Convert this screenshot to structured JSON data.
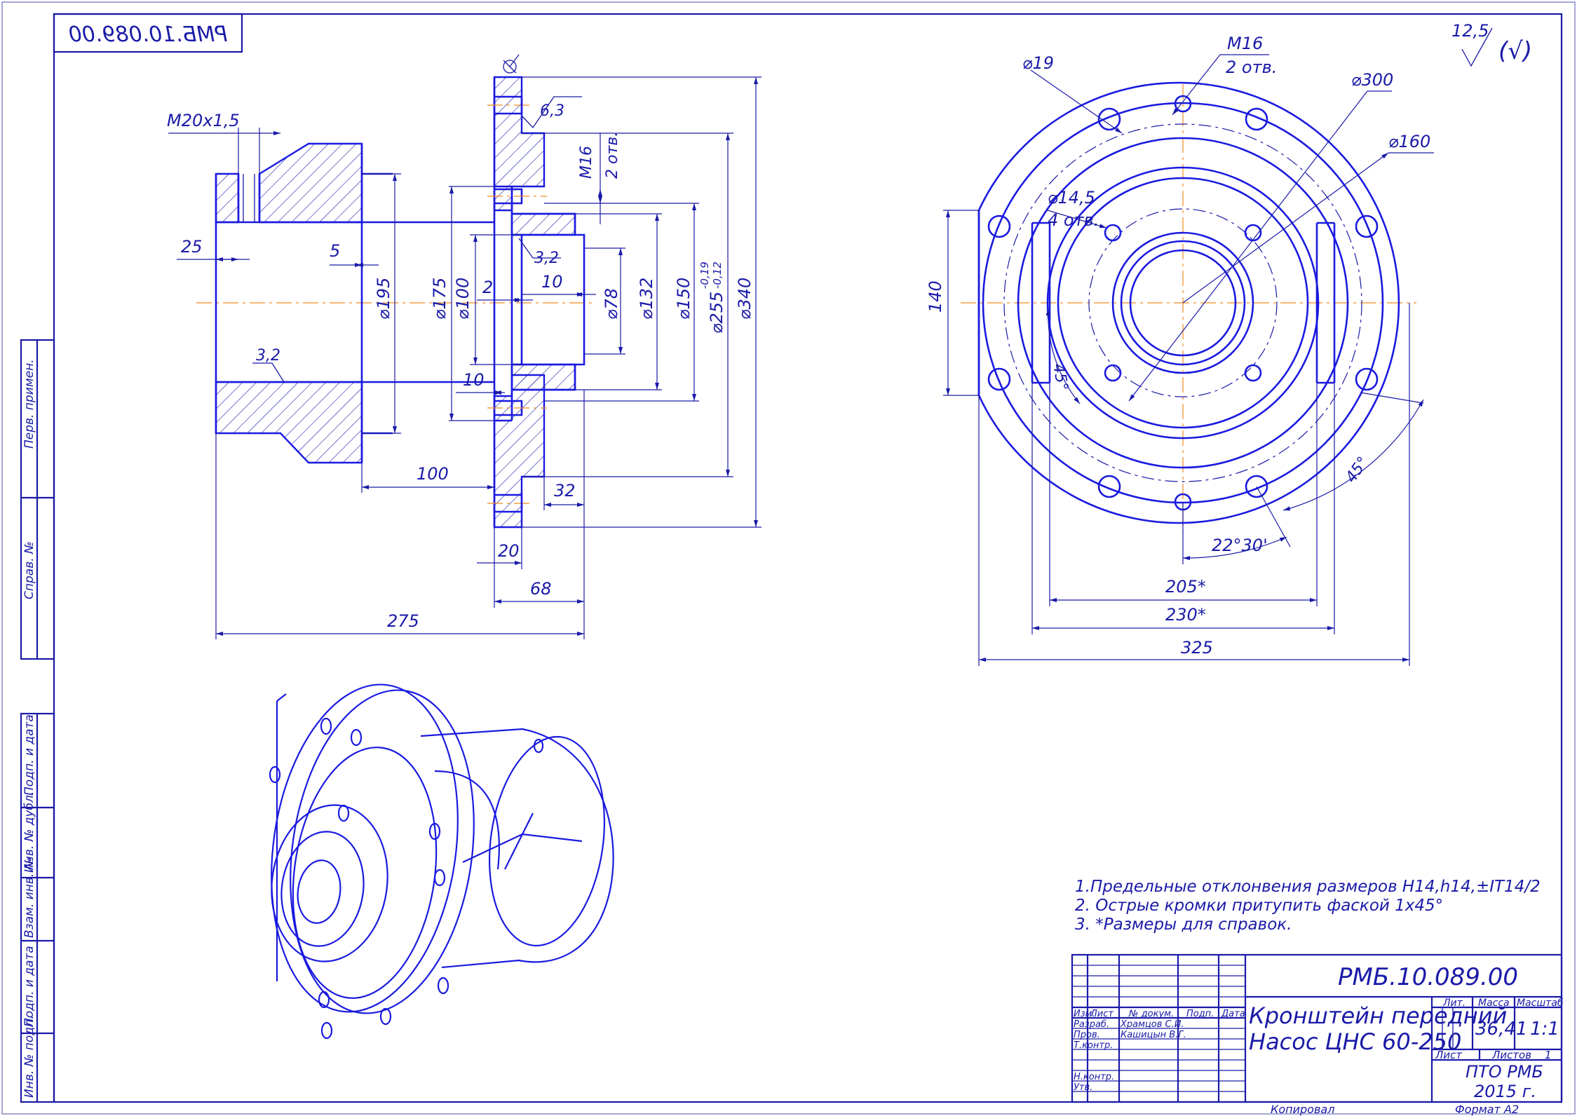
{
  "drawing": {
    "number": "РМБ.10.089.00",
    "number_mirrored": "РМБ.10.089.00",
    "title_line1": "Кронштейн передний",
    "title_line2": "Насос ЦНС 60-250",
    "mass": "36,41",
    "scale": "1:1",
    "sheet": "1",
    "organization": "ПТО РМБ",
    "year": "2015 г.",
    "format": "Формат    А2",
    "copied": "Копировал",
    "roughness_value": "12,5",
    "roughness_symbol": "(√)"
  },
  "title_block": {
    "col_izm": "Изм.",
    "col_list": "Лист",
    "col_doc": "№ докум.",
    "col_sign": "Подп.",
    "col_date": "Дата",
    "rows": [
      {
        "role": "Разраб.",
        "name": "Храмцов С.И."
      },
      {
        "role": "Пров.",
        "name": "Кашицын В.Г."
      },
      {
        "role": "Т.контр.",
        "name": ""
      },
      {
        "role": "",
        "name": ""
      },
      {
        "role": "Н.контр.",
        "name": ""
      },
      {
        "role": "Утв.",
        "name": ""
      }
    ],
    "lit_label": "Лит.",
    "mass_label": "Масса",
    "scale_label": "Масштаб",
    "sheet_label": "Лист",
    "sheets_label": "Листов"
  },
  "side_stamps": [
    "Перв. примен.",
    "Справ. №",
    "Подп. и дата",
    "Инв. № дубл.",
    "Взам. инв. №",
    "Подп. и дата",
    "Инв. № подл."
  ],
  "notes": [
    "1.Предельные отклонвения размеров H14,h14,±IT14/2",
    "2. Острые кромки притупить фаской 1х45°",
    "3. *Размеры для справок."
  ],
  "section_view": {
    "thread": "M20x1,5",
    "d195": "⌀195",
    "d175": "⌀175",
    "d100": "⌀100",
    "d78": "⌀78",
    "d132": "⌀132",
    "d150": "⌀150",
    "d255": "⌀255",
    "d255_tol_upper": "-0,19",
    "d255_tol_lower": "-0,12",
    "d340": "⌀340",
    "len25": "25",
    "len5": "5",
    "len2": "2",
    "len10a": "10",
    "len10b": "10",
    "len100": "100",
    "len32": "32",
    "len20": "20",
    "len68": "68",
    "len275": "275",
    "rough63": "6,3",
    "rough32a": "3,2",
    "rough32b": "3,2",
    "m16": "M16",
    "m16_holes": "2 отв."
  },
  "front_view": {
    "d19": "⌀19",
    "m16": "M16",
    "m16_holes": "2 отв.",
    "d300": "⌀300",
    "d160": "⌀160",
    "d145": "⌀14,5",
    "d145_holes": "4 отв.",
    "h140": "140",
    "ang45a": "45°",
    "ang45b": "45°",
    "ang2230": "22°30'",
    "w205": "205*",
    "w230": "230*",
    "w325": "325"
  }
}
